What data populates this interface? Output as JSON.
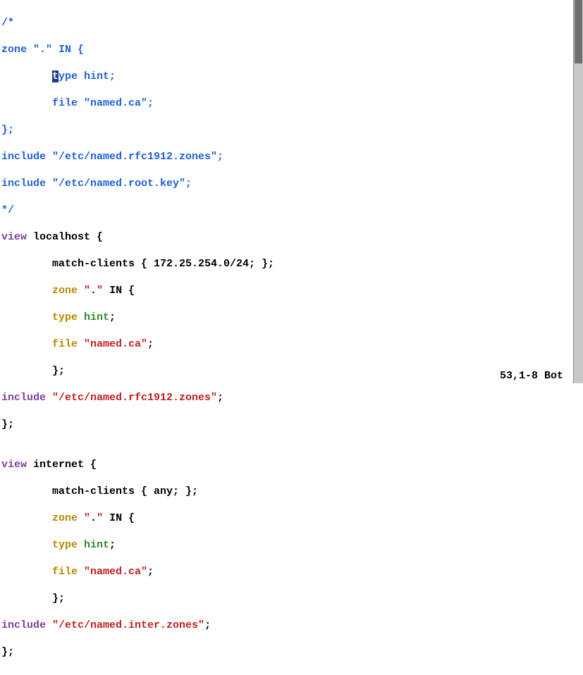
{
  "c": {
    "l1": "/*",
    "l2a": "zone ",
    "l2b": "\".\"",
    "l2c": " IN {",
    "l3pad": "        ",
    "l3cur": "t",
    "l3rest": "ype hint;",
    "l4": "        file \"named.ca\";",
    "l5": "};",
    "l6": "include \"/etc/named.rfc1912.zones\";",
    "l7": "include \"/etc/named.root.key\";",
    "l8": "*/"
  },
  "v1": {
    "l1a": "view",
    "l1b": " localhost {",
    "l2": "        match-clients { 172.25.254.0/24; };",
    "l3p": "        ",
    "l3a": "zone ",
    "l3b": "\"",
    "l3c": ".",
    "l3d": "\"",
    "l3e": " IN ",
    "l3f": "{",
    "l4p": "        ",
    "l4a": "type ",
    "l4b": "hint",
    "l4c": ";",
    "l5p": "        ",
    "l5a": "file ",
    "l5b": "\"named.ca\"",
    "l5c": ";",
    "l6": "        };",
    "l7a": "include ",
    "l7b": "\"/etc/named.rfc1912.zones\"",
    "l7c": ";",
    "l8": "};"
  },
  "v2": {
    "l0": "",
    "l1a": "view",
    "l1b": " internet {",
    "l2": "        match-clients { any; };",
    "l3p": "        ",
    "l3a": "zone ",
    "l3b": "\"",
    "l3c": ".",
    "l3d": "\"",
    "l3e": " IN ",
    "l3f": "{",
    "l4p": "        ",
    "l4a": "type ",
    "l4b": "hint",
    "l4c": ";",
    "l5p": "        ",
    "l5a": "file ",
    "l5b": "\"named.ca\"",
    "l5c": ";",
    "l6": "        };",
    "l7a": "include ",
    "l7b": "\"/etc/named.inter.zones\"",
    "l7c": ";",
    "l8": "};"
  },
  "status": {
    "pos": "53,1-8",
    "where": "Bot"
  }
}
